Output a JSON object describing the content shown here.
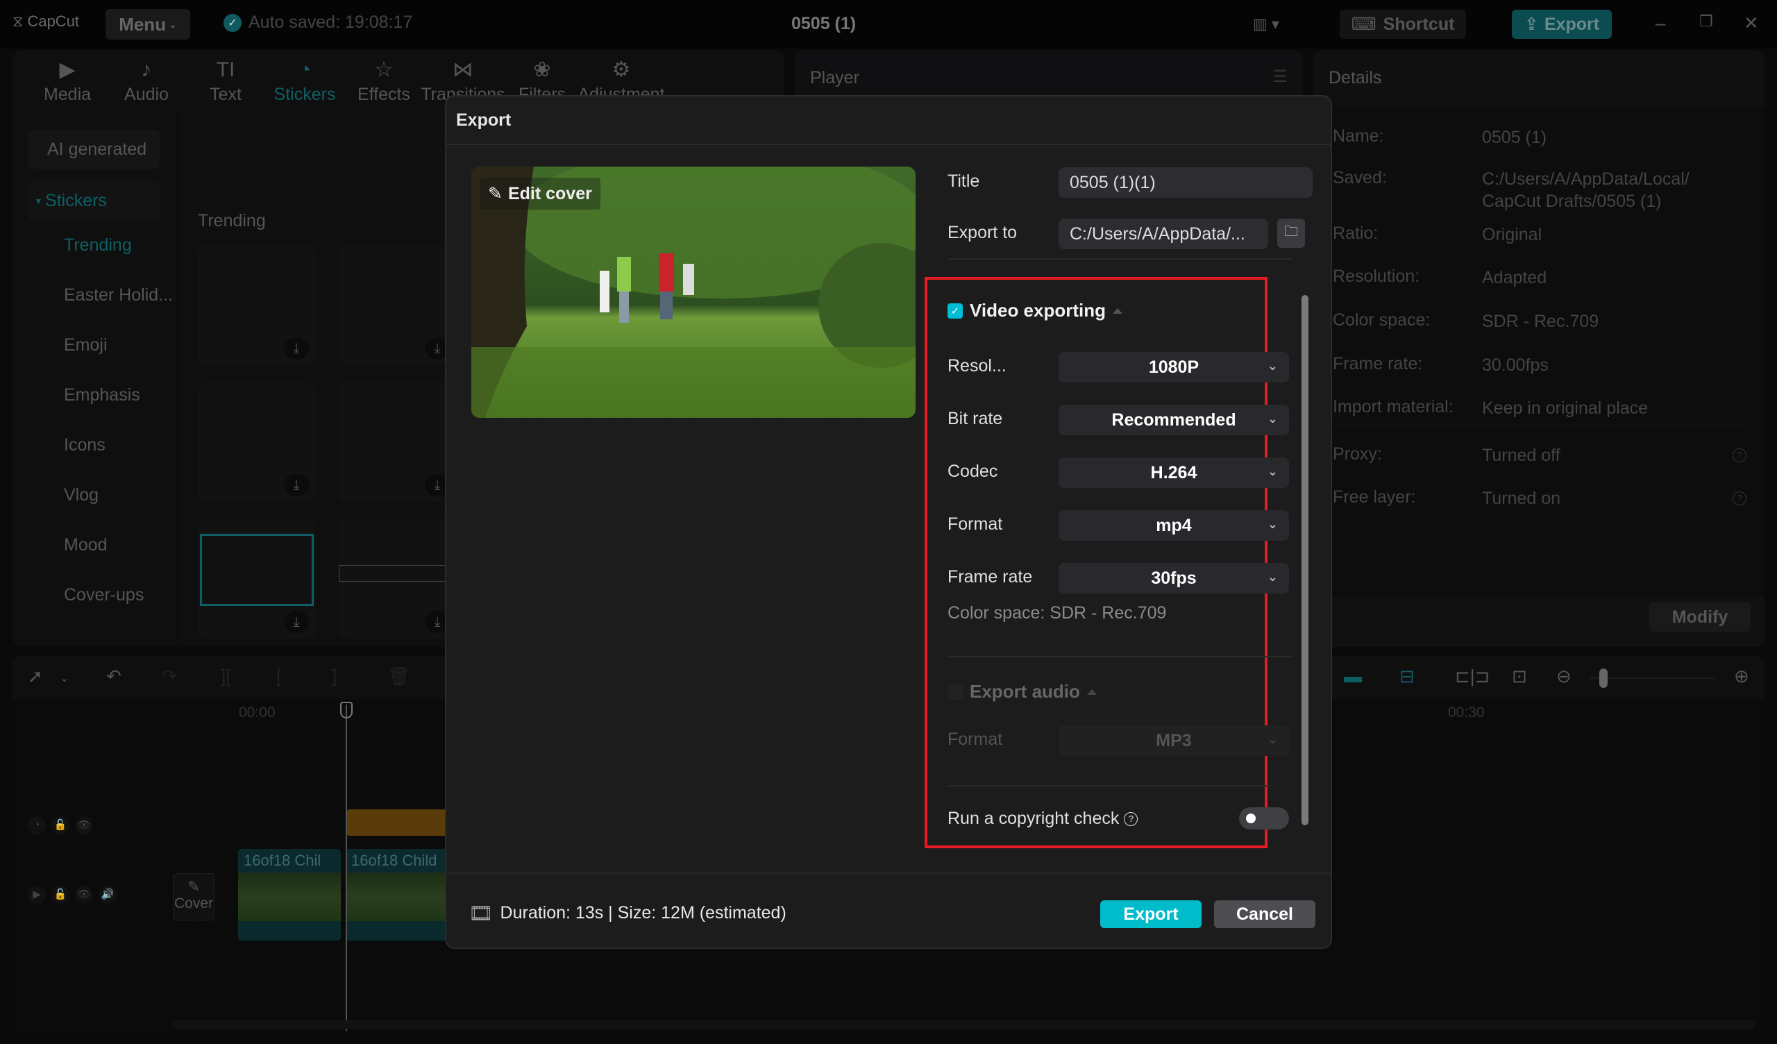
{
  "app": {
    "logo": "CapCut",
    "menu_label": "Menu",
    "autosave": "Auto saved: 19:08:17",
    "project_title": "0505 (1)",
    "shortcut_label": "Shortcut",
    "export_label": "Export"
  },
  "toolbar_tabs": [
    {
      "label": "Media",
      "icon": "media-icon",
      "glyph": "▶"
    },
    {
      "label": "Audio",
      "icon": "audio-icon",
      "glyph": "♪"
    },
    {
      "label": "Text",
      "icon": "text-icon",
      "glyph": "TI"
    },
    {
      "label": "Stickers",
      "icon": "stickers-icon",
      "glyph": "◔",
      "active": true
    },
    {
      "label": "Effects",
      "icon": "effects-icon",
      "glyph": "☆"
    },
    {
      "label": "Transitions",
      "icon": "transitions-icon",
      "glyph": "⋈"
    },
    {
      "label": "Filters",
      "icon": "filters-icon",
      "glyph": "❀"
    },
    {
      "label": "Adjustment",
      "icon": "adjustment-icon",
      "glyph": "⚙"
    }
  ],
  "stickers_panel": {
    "ai_generated": "AI generated",
    "stickers_group": "Stickers",
    "categories": [
      "Trending",
      "Easter Holid...",
      "Emoji",
      "Emphasis",
      "Icons",
      "Vlog",
      "Mood",
      "Cover-ups"
    ],
    "active_category": "Trending",
    "section_title": "Trending"
  },
  "player": {
    "title": "Player"
  },
  "details": {
    "title": "Details",
    "rows": [
      {
        "key": "Name:",
        "value": "0505 (1)"
      },
      {
        "key": "Saved:",
        "value": "C:/Users/A/AppData/Local/ CapCut Drafts/0505 (1)"
      },
      {
        "key": "Ratio:",
        "value": "Original"
      },
      {
        "key": "Resolution:",
        "value": "Adapted"
      },
      {
        "key": "Color space:",
        "value": "SDR - Rec.709"
      },
      {
        "key": "Frame rate:",
        "value": "30.00fps"
      },
      {
        "key": "Import material:",
        "value": "Keep in original place"
      },
      {
        "key": "Proxy:",
        "value": "Turned off"
      },
      {
        "key": "Free layer:",
        "value": "Turned on"
      }
    ],
    "modify_label": "Modify"
  },
  "timeline": {
    "ruler": [
      "00:00",
      "00:30"
    ],
    "cover_label": "Cover",
    "clips": [
      "16of18 Chil",
      "16of18 Child"
    ]
  },
  "export_dialog": {
    "title": "Export",
    "edit_cover": "Edit cover",
    "title_label": "Title",
    "title_value": "0505 (1)(1)",
    "export_to_label": "Export to",
    "export_to_value": "C:/Users/A/AppData/...",
    "video": {
      "heading": "Video exporting",
      "checked": true,
      "rows": [
        {
          "label": "Resol...",
          "value": "1080P"
        },
        {
          "label": "Bit rate",
          "value": "Recommended"
        },
        {
          "label": "Codec",
          "value": "H.264"
        },
        {
          "label": "Format",
          "value": "mp4"
        },
        {
          "label": "Frame rate",
          "value": "30fps"
        }
      ],
      "color_space": "Color space: SDR - Rec.709"
    },
    "audio": {
      "heading": "Export audio",
      "checked": false,
      "format_label": "Format",
      "format_value": "MP3"
    },
    "copyright_label": "Run a copyright check",
    "copyright_enabled": false,
    "footer_info": "Duration: 13s | Size: 12M (estimated)",
    "export_button": "Export",
    "cancel_button": "Cancel"
  },
  "colors": {
    "accent": "#00bcca",
    "highlight_box": "#e51c23",
    "checkbox": "#00bcd4"
  }
}
